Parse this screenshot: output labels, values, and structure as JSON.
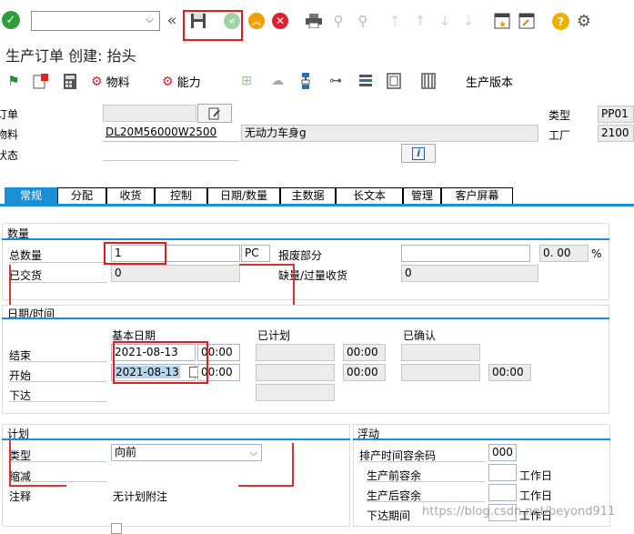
{
  "toolbar": {
    "command_value": "",
    "watermark": "https://blog.csdn.net/beyond911"
  },
  "title": "生产订单 创建: 抬头",
  "functions": {
    "material": "物料",
    "capacity": "能力",
    "version": "生产版本"
  },
  "header": {
    "order_label": "订单",
    "order_value": "",
    "material_label": "物料",
    "material_value": "DL20M56000W2500",
    "material_desc": "无动力车身g",
    "status_label": "状态",
    "type_label": "类型",
    "type_value": "PP01",
    "plant_label": "工厂",
    "plant_value": "2100"
  },
  "tabs": [
    {
      "label": "常规"
    },
    {
      "label": "分配"
    },
    {
      "label": "收货"
    },
    {
      "label": "控制"
    },
    {
      "label": "日期/数量"
    },
    {
      "label": "主数据"
    },
    {
      "label": "长文本"
    },
    {
      "label": "管理"
    },
    {
      "label": "客户屏幕"
    }
  ],
  "quantity": {
    "title": "数量",
    "total_label": "总数量",
    "total_value": "1",
    "unit": "PC",
    "scrap_label": "报废部分",
    "scrap_value": "",
    "scrap_pct": "0. 00",
    "pct_sign": "%",
    "delivered_label": "已交货",
    "delivered_value": "0",
    "short_label": "缺量/过量收货",
    "short_value": "0"
  },
  "dates": {
    "title": "日期/时间",
    "col_basic": "基本日期",
    "col_sched": "已计划",
    "col_conf": "已确认",
    "end_label": "结束",
    "end_date": "2021-08-13",
    "end_time": "00:00",
    "end_sched_time": "00:00",
    "start_label": "开始",
    "start_date": "2021-08-13",
    "start_time": "00:00",
    "start_sched_time": "00:00",
    "start_conf_time": "00:00",
    "release_label": "下达"
  },
  "plan": {
    "title": "计划",
    "type_label": "类型",
    "type_value": "向前",
    "reduce_label": "缩减",
    "note_label": "注释",
    "note_value": "无计划附注"
  },
  "float": {
    "title": "浮动",
    "sched_margin_label": "排产时间容余码",
    "sched_margin_value": "000",
    "pre_float_label": "生产前容余",
    "post_float_label": "生产后容余",
    "release_period_label": "下达期间",
    "unit": "工作日"
  }
}
